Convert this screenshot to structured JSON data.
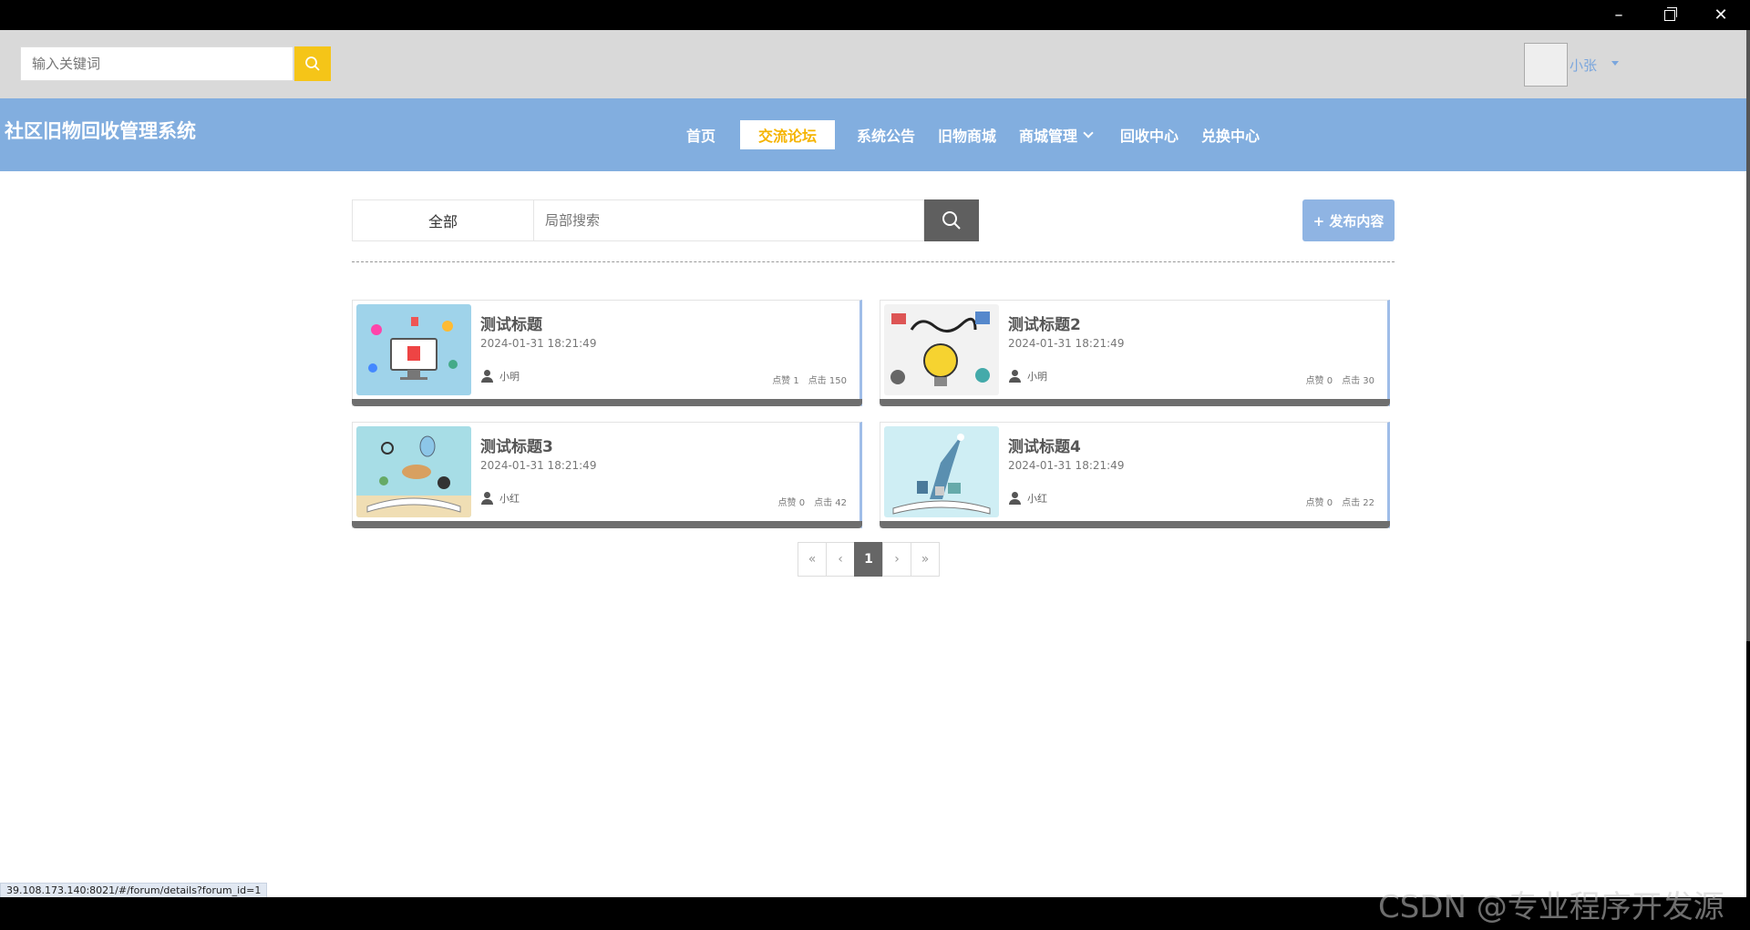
{
  "window": {
    "minimize_glyph": "–",
    "close_glyph": "✕"
  },
  "topbar": {
    "keyword_placeholder": "输入关键词",
    "user_name": "小张"
  },
  "header": {
    "site_title": "社区旧物回收管理系统",
    "nav": [
      {
        "label": "首页",
        "active": false
      },
      {
        "label": "交流论坛",
        "active": true
      },
      {
        "label": "系统公告",
        "active": false
      },
      {
        "label": "旧物商城",
        "active": false
      },
      {
        "label": "商城管理",
        "active": false,
        "dropdown": true
      },
      {
        "label": "回收中心",
        "active": false
      },
      {
        "label": "兑换中心",
        "active": false
      }
    ]
  },
  "forum": {
    "category": "全部",
    "search_placeholder": "局部搜索",
    "publish_label": "+ 发布内容",
    "posts": [
      {
        "title": "测试标题",
        "date": "2024-01-31 18:21:49",
        "author": "小明",
        "likes": "点赞 1",
        "clicks": "点击 150"
      },
      {
        "title": "测试标题2",
        "date": "2024-01-31 18:21:49",
        "author": "小明",
        "likes": "点赞 0",
        "clicks": "点击 30"
      },
      {
        "title": "测试标题3",
        "date": "2024-01-31 18:21:49",
        "author": "小红",
        "likes": "点赞 0",
        "clicks": "点击 42"
      },
      {
        "title": "测试标题4",
        "date": "2024-01-31 18:21:49",
        "author": "小红",
        "likes": "点赞 0",
        "clicks": "点击 22"
      }
    ]
  },
  "pagination": {
    "first": "«",
    "prev": "‹",
    "current": "1",
    "next": "›",
    "last": "»"
  },
  "status_url": "39.108.173.140:8021/#/forum/details?forum_id=1",
  "watermark": "CSDN @专业程序开发源",
  "colors": {
    "nav_bg": "#82aedf",
    "accent": "#f5c518",
    "active_text": "#f5b400"
  }
}
